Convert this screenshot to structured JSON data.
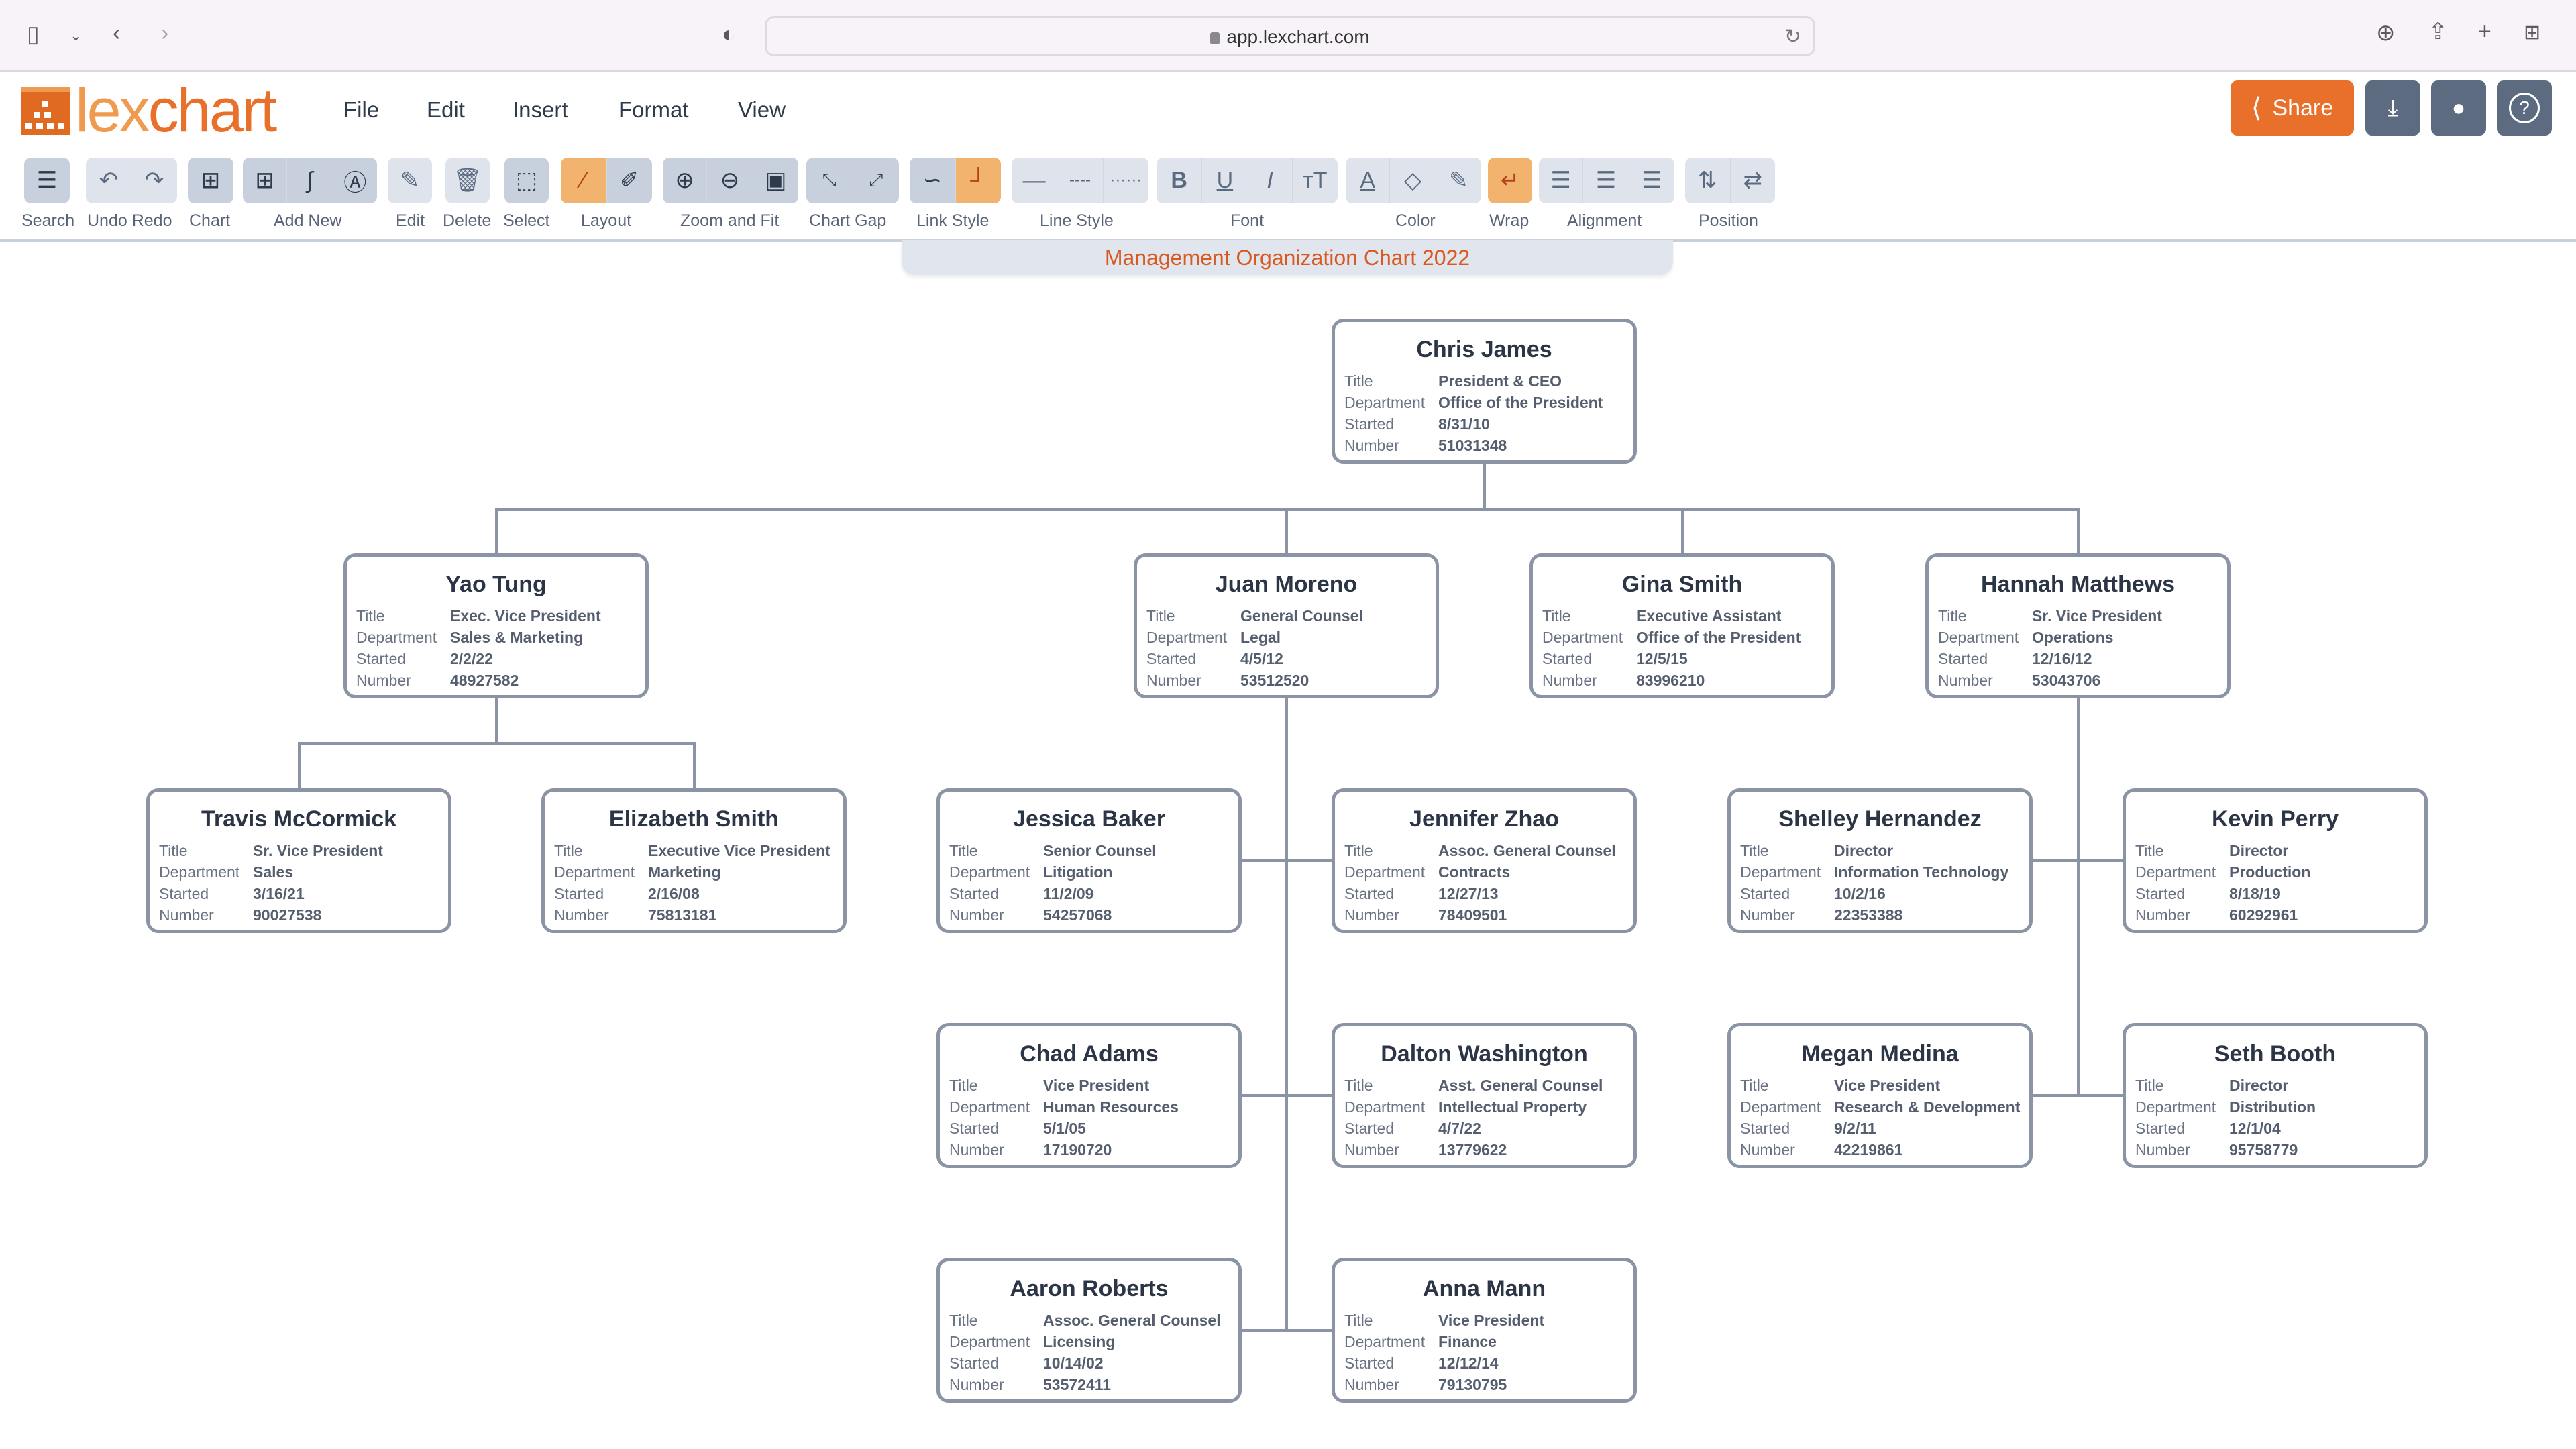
{
  "browser": {
    "url": "app.lexchart.com",
    "icons": [
      "sidebar-icon",
      "chevron-down-icon",
      "back-icon",
      "forward-icon",
      "shield-icon",
      "reload-icon",
      "download-icon",
      "share-icon",
      "new-tab-icon",
      "tab-overview-icon"
    ]
  },
  "app": {
    "logo_text_a": "lex",
    "logo_text_b": "chart",
    "menu": [
      "File",
      "Edit",
      "Insert",
      "Format",
      "View"
    ],
    "share_label": "Share",
    "accent": "#e8702a",
    "header_buttons": [
      "download-icon",
      "user-icon",
      "help-icon"
    ]
  },
  "toolbar": {
    "groups": [
      {
        "label": "Search",
        "icons": [
          "search-list-icon"
        ]
      },
      {
        "label": "Undo Redo",
        "icons": [
          "undo-icon",
          "redo-icon"
        ]
      },
      {
        "label": "Chart",
        "icons": [
          "chart-grid-icon"
        ]
      },
      {
        "label": "Add New",
        "icons": [
          "add-box-icon",
          "add-link-icon",
          "add-text-icon"
        ]
      },
      {
        "label": "Edit",
        "icons": [
          "pencil-icon"
        ]
      },
      {
        "label": "Delete",
        "icons": [
          "trash-icon"
        ]
      },
      {
        "label": "Select",
        "icons": [
          "select-icon"
        ]
      },
      {
        "label": "Layout",
        "icons": [
          "auto-layout-wand-icon",
          "manual-layout-icon"
        ]
      },
      {
        "label": "Zoom and Fit",
        "icons": [
          "zoom-in-icon",
          "zoom-out-icon",
          "fit-icon"
        ]
      },
      {
        "label": "Chart Gap",
        "icons": [
          "expand-gap-icon",
          "shrink-gap-icon"
        ]
      },
      {
        "label": "Link Style",
        "icons": [
          "curved-link-icon",
          "elbow-link-icon"
        ]
      },
      {
        "label": "Line Style",
        "icons": [
          "solid-line-icon",
          "dashed-line-icon",
          "dotted-line-icon"
        ]
      },
      {
        "label": "Font",
        "icons": [
          "bold-icon",
          "underline-icon",
          "italic-icon",
          "font-size-icon"
        ]
      },
      {
        "label": "Color",
        "icons": [
          "text-color-icon",
          "fill-color-icon",
          "line-color-icon"
        ]
      },
      {
        "label": "Wrap",
        "icons": [
          "wrap-icon"
        ]
      },
      {
        "label": "Alignment",
        "icons": [
          "align-left-icon",
          "align-center-icon",
          "align-right-icon"
        ]
      },
      {
        "label": "Position",
        "icons": [
          "vertical-position-icon",
          "horizontal-position-icon"
        ]
      }
    ],
    "glyphs": {
      "b": "B",
      "u": "U",
      "i": "I",
      "tt": "тT",
      "a": "A"
    }
  },
  "chart": {
    "title": "Management Organization Chart 2022",
    "field_labels": {
      "title": "Title",
      "department": "Department",
      "started": "Started",
      "number": "Number"
    },
    "nodes": [
      {
        "name": "Chris James",
        "title": "President & CEO",
        "department": "Office of the President",
        "started": "8/31/10",
        "number": "51031348"
      },
      {
        "name": "Yao Tung",
        "title": "Exec. Vice President",
        "department": "Sales & Marketing",
        "started": "2/2/22",
        "number": "48927582"
      },
      {
        "name": "Juan Moreno",
        "title": "General Counsel",
        "department": "Legal",
        "started": "4/5/12",
        "number": "53512520"
      },
      {
        "name": "Gina Smith",
        "title": "Executive Assistant",
        "department": "Office of the President",
        "started": "12/5/15",
        "number": "83996210"
      },
      {
        "name": "Hannah Matthews",
        "title": "Sr. Vice President",
        "department": "Operations",
        "started": "12/16/12",
        "number": "53043706"
      },
      {
        "name": "Travis McCormick",
        "title": "Sr. Vice President",
        "department": "Sales",
        "started": "3/16/21",
        "number": "90027538"
      },
      {
        "name": "Elizabeth Smith",
        "title": "Executive Vice President",
        "department": "Marketing",
        "started": "2/16/08",
        "number": "75813181"
      },
      {
        "name": "Jessica Baker",
        "title": "Senior Counsel",
        "department": "Litigation",
        "started": "11/2/09",
        "number": "54257068"
      },
      {
        "name": "Jennifer Zhao",
        "title": "Assoc. General Counsel",
        "department": "Contracts",
        "started": "12/27/13",
        "number": "78409501"
      },
      {
        "name": "Shelley Hernandez",
        "title": "Director",
        "department": "Information Technology",
        "started": "10/2/16",
        "number": "22353388"
      },
      {
        "name": "Kevin Perry",
        "title": "Director",
        "department": "Production",
        "started": "8/18/19",
        "number": "60292961"
      },
      {
        "name": "Chad Adams",
        "title": "Vice President",
        "department": "Human Resources",
        "started": "5/1/05",
        "number": "17190720"
      },
      {
        "name": "Dalton Washington",
        "title": "Asst. General Counsel",
        "department": "Intellectual Property",
        "started": "4/7/22",
        "number": "13779622"
      },
      {
        "name": "Megan Medina",
        "title": "Vice President",
        "department": "Research & Development",
        "started": "9/2/11",
        "number": "42219861"
      },
      {
        "name": "Seth Booth",
        "title": "Director",
        "department": "Distribution",
        "started": "12/1/04",
        "number": "95758779"
      },
      {
        "name": "Aaron Roberts",
        "title": "Assoc. General Counsel",
        "department": "Licensing",
        "started": "10/14/02",
        "number": "53572411"
      },
      {
        "name": "Anna Mann",
        "title": "Vice President",
        "department": "Finance",
        "started": "12/12/14",
        "number": "79130795"
      }
    ]
  }
}
